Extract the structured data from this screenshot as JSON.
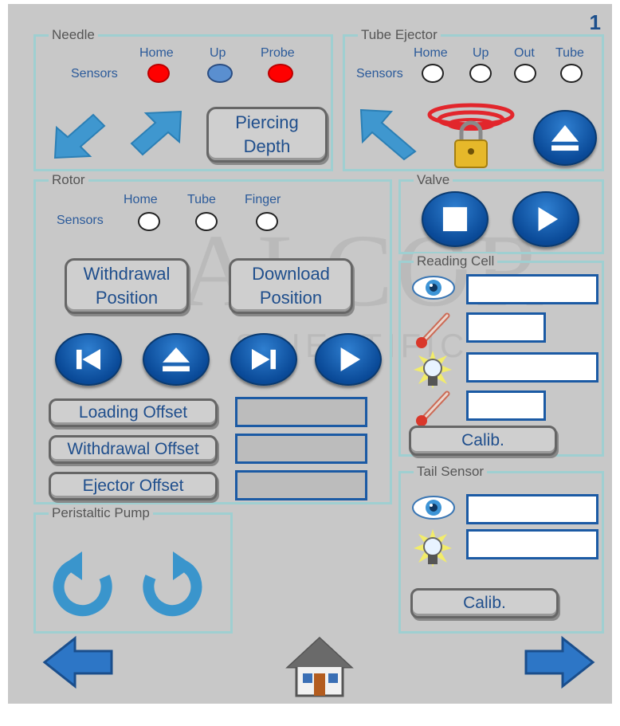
{
  "page_number": "1",
  "watermark": {
    "line1": "ALCOR",
    "line2": "SCIENTIFIC"
  },
  "needle": {
    "title": "Needle",
    "sensors_label": "Sensors",
    "sensors": [
      {
        "label": "Home",
        "state": "red"
      },
      {
        "label": "Up",
        "state": "blue"
      },
      {
        "label": "Probe",
        "state": "red"
      }
    ],
    "piercing_line1": "Piercing",
    "piercing_line2": "Depth"
  },
  "tube_ejector": {
    "title": "Tube Ejector",
    "sensors_label": "Sensors",
    "sensors": [
      {
        "label": "Home"
      },
      {
        "label": "Up"
      },
      {
        "label": "Out"
      },
      {
        "label": "Tube"
      }
    ]
  },
  "rotor": {
    "title": "Rotor",
    "sensors_label": "Sensors",
    "sensors": [
      {
        "label": "Home"
      },
      {
        "label": "Tube"
      },
      {
        "label": "Finger"
      }
    ],
    "withdrawal_line1": "Withdrawal",
    "withdrawal_line2": "Position",
    "download_line1": "Download",
    "download_line2": "Position",
    "loading_offset": "Loading Offset",
    "withdrawal_offset": "Withdrawal Offset",
    "ejector_offset": "Ejector Offset"
  },
  "valve": {
    "title": "Valve"
  },
  "reading_cell": {
    "title": "Reading Cell",
    "calib": "Calib."
  },
  "tail_sensor": {
    "title": "Tail Sensor",
    "calib": "Calib."
  },
  "peristaltic_pump": {
    "title": "Peristaltic Pump"
  },
  "colors": {
    "accent": "#1c4f8c",
    "frame": "#9fcfd1",
    "sensor_on": "#ff0000",
    "sensor_up": "#5a8fd0"
  },
  "icons": [
    "arrow-down-left-icon",
    "arrow-up-right-icon",
    "arrow-up-left-icon",
    "locked-alarm-icon",
    "eject-icon",
    "stop-icon",
    "play-icon",
    "skip-back-icon",
    "skip-forward-icon",
    "eye-icon",
    "thermometer-icon",
    "bulb-icon",
    "rotate-ccw-icon",
    "rotate-cw-icon",
    "arrow-left-icon",
    "home-icon",
    "arrow-right-icon"
  ]
}
